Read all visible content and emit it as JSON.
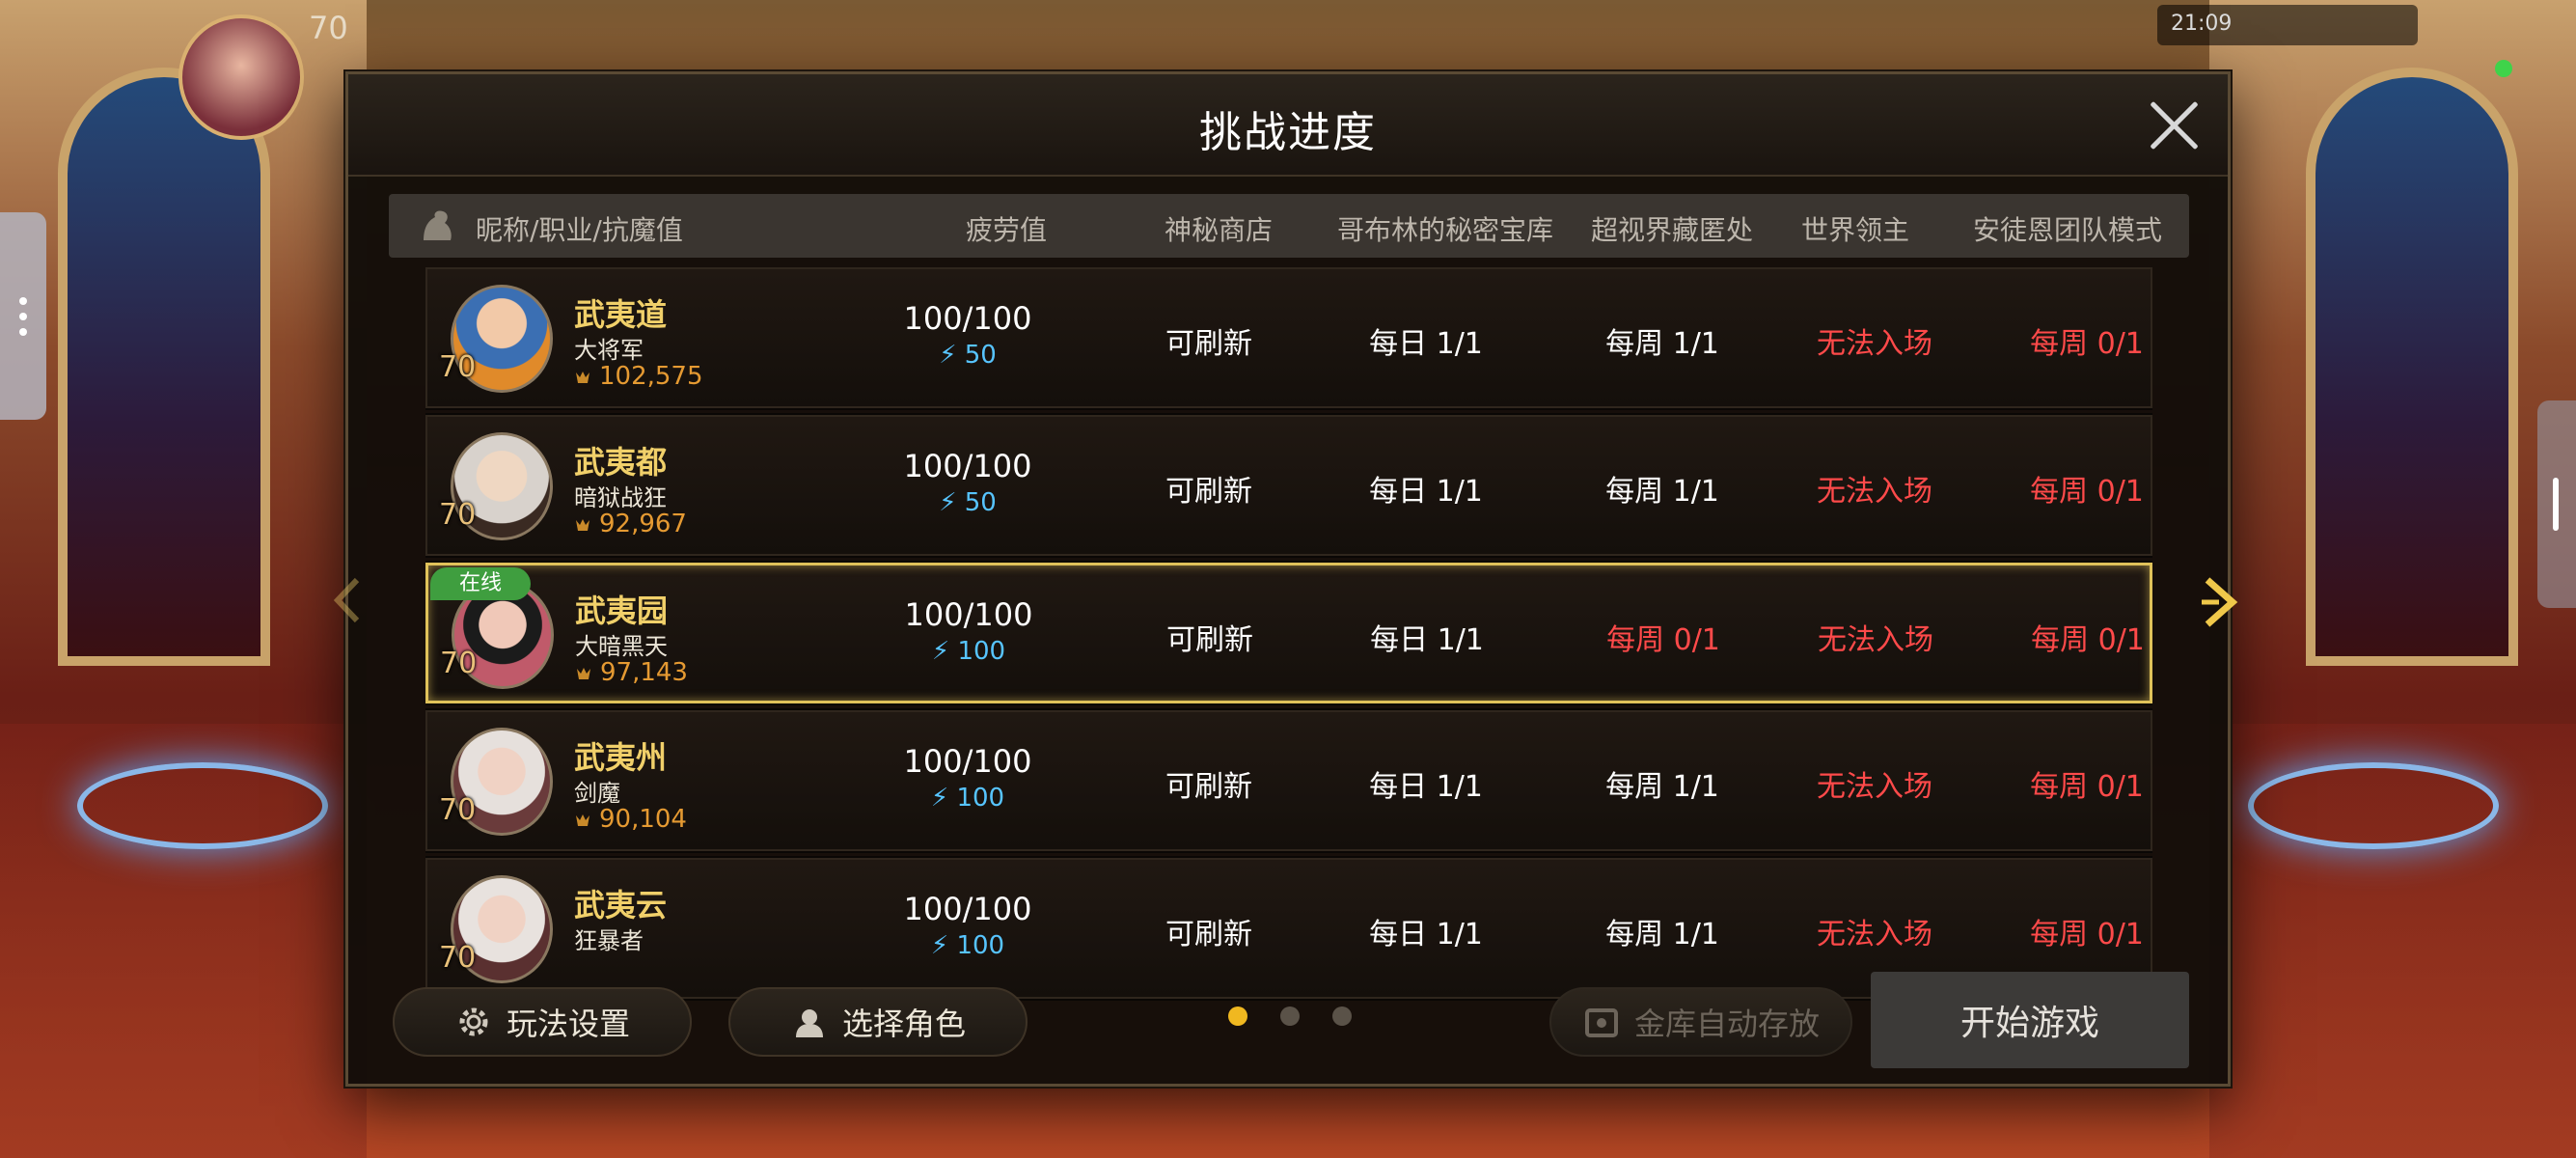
{
  "background": {
    "player_level": "70",
    "clock": "21:09"
  },
  "modal": {
    "title": "挑战进度"
  },
  "columns": {
    "name": "昵称/职业/抗魔值",
    "fatigue": "疲劳值",
    "shop": "神秘商店",
    "goblin": "哥布林的秘密宝库",
    "hidden": "超视界藏匿处",
    "lord": "世界领主",
    "team": "安徒恩团队模式"
  },
  "characters": [
    {
      "name": "武夷道",
      "class": "大将军",
      "power": "102,575",
      "level": "70",
      "fatigue": "100/100",
      "energy": "50",
      "shop": "可刷新",
      "goblin": "每日 1/1",
      "hidden": "每周 1/1",
      "lord": "无法入场",
      "team": "每周 0/1",
      "online": ""
    },
    {
      "name": "武夷都",
      "class": "暗狱战狂",
      "power": "92,967",
      "level": "70",
      "fatigue": "100/100",
      "energy": "50",
      "shop": "可刷新",
      "goblin": "每日 1/1",
      "hidden": "每周 1/1",
      "lord": "无法入场",
      "team": "每周 0/1",
      "online": ""
    },
    {
      "name": "武夷园",
      "class": "大暗黑天",
      "power": "97,143",
      "level": "70",
      "fatigue": "100/100",
      "energy": "100",
      "shop": "可刷新",
      "goblin": "每日 1/1",
      "hidden": "每周 0/1",
      "lord": "无法入场",
      "team": "每周 0/1",
      "online": "在线"
    },
    {
      "name": "武夷州",
      "class": "剑魔",
      "power": "90,104",
      "level": "70",
      "fatigue": "100/100",
      "energy": "100",
      "shop": "可刷新",
      "goblin": "每日 1/1",
      "hidden": "每周 1/1",
      "lord": "无法入场",
      "team": "每周 0/1",
      "online": ""
    },
    {
      "name": "武夷云",
      "class": "狂暴者",
      "power": "",
      "level": "70",
      "fatigue": "100/100",
      "energy": "100",
      "shop": "可刷新",
      "goblin": "每日 1/1",
      "hidden": "每周 1/1",
      "lord": "无法入场",
      "team": "每周 0/1",
      "online": ""
    }
  ],
  "footer": {
    "settings": "玩法设置",
    "select_character": "选择角色",
    "auto_store": "金库自动存放",
    "start_game": "开始游戏",
    "page_current": 1,
    "page_total": 3
  },
  "colors": {
    "name_gold": "#f1d06a",
    "red": "#ff4a4a",
    "energy_blue": "#57c4ff",
    "power_orange": "#e59a32",
    "selected_border": "#e0c25a",
    "online_green": "#3f9e3f"
  },
  "icons": {
    "close": "close-icon",
    "gear": "gear-icon",
    "character": "character-icon",
    "vault": "vault-icon",
    "lightning": "lightning-icon",
    "arrow_right": "chevron-right-icon",
    "arrow_left": "chevron-left-icon"
  }
}
